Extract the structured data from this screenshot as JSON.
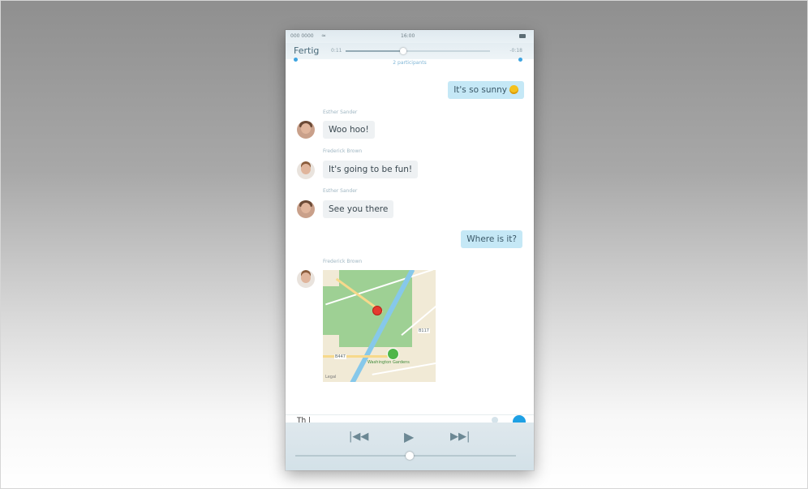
{
  "status_bar": {
    "carrier": "000 0000",
    "wifi_icon": "wifi-icon",
    "time": "16:00"
  },
  "player_top": {
    "done_label": "Fertig",
    "elapsed": "0:11",
    "remaining": "-0:18",
    "position_fraction": 0.4
  },
  "chat": {
    "subtitle": "2 participants",
    "messages": [
      {
        "direction": "out",
        "text": "It's so sunny",
        "emoji": "smiling-face-icon"
      },
      {
        "direction": "in",
        "sender": "Esther Sander",
        "avatar": "woman-avatar",
        "text": "Woo hoo!"
      },
      {
        "direction": "in",
        "sender": "Frederick Brown",
        "avatar": "man-avatar",
        "text": "It's going to be fun!"
      },
      {
        "direction": "in",
        "sender": "Esther Sander",
        "avatar": "woman-avatar",
        "text": "See you there"
      },
      {
        "direction": "out",
        "text": "Where is it?"
      },
      {
        "direction": "in",
        "sender": "Frederick Brown",
        "avatar": "man-avatar",
        "type": "map",
        "map": {
          "poi_label": "Washington Gardens",
          "road_label_1": "B117",
          "road_label_2": "B447",
          "attribution": "Legal"
        }
      }
    ]
  },
  "composer": {
    "input_text": "Th |",
    "send_icon": "send-icon",
    "mic_icon": "microphone-icon"
  },
  "media_controls": {
    "previous": "|◀◀",
    "play": "▶",
    "next": "▶▶|",
    "volume_fraction": 0.52
  },
  "colors": {
    "outgoing_bubble": "#c5e8f6",
    "incoming_bubble": "#eef1f3",
    "accent": "#1ea0e4",
    "sender_name": "#9fb6c2"
  }
}
